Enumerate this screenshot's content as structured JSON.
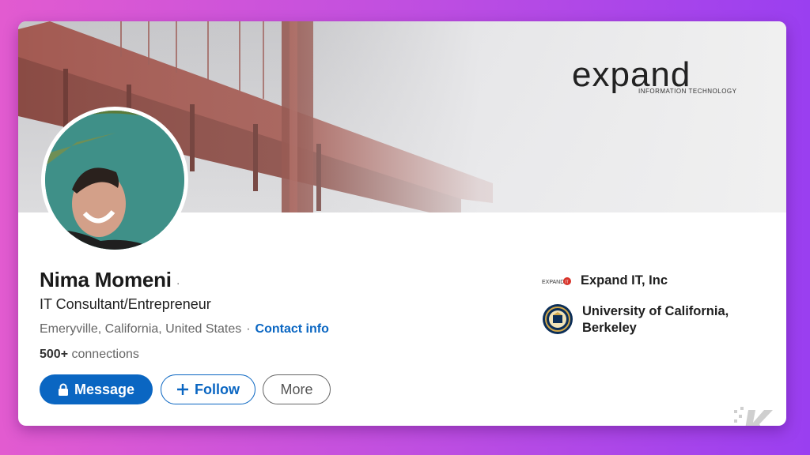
{
  "profile": {
    "name": "Nima Momeni",
    "name_suffix": "·",
    "headline": "IT Consultant/Entrepreneur",
    "location": "Emeryville, California, United States",
    "location_separator": "·",
    "contact_link": "Contact info",
    "connections_count": "500+",
    "connections_label": "connections"
  },
  "banner": {
    "brand_word": "expand",
    "brand_tagline": "INFORMATION TECHNOLOGY"
  },
  "actions": {
    "message_label": "Message",
    "follow_label": "Follow",
    "more_label": "More"
  },
  "organizations": [
    {
      "name": "Expand IT, Inc",
      "logo_text": "EXPAND IT",
      "icon": "company-logo"
    },
    {
      "name": "University of California, Berkeley",
      "icon": "university-seal"
    }
  ],
  "icons": {
    "message": "lock-icon",
    "follow": "plus-icon"
  },
  "colors": {
    "primary": "#0a66c2",
    "background_gradient_start": "#e25bd0",
    "background_gradient_end": "#9a3ff0"
  }
}
